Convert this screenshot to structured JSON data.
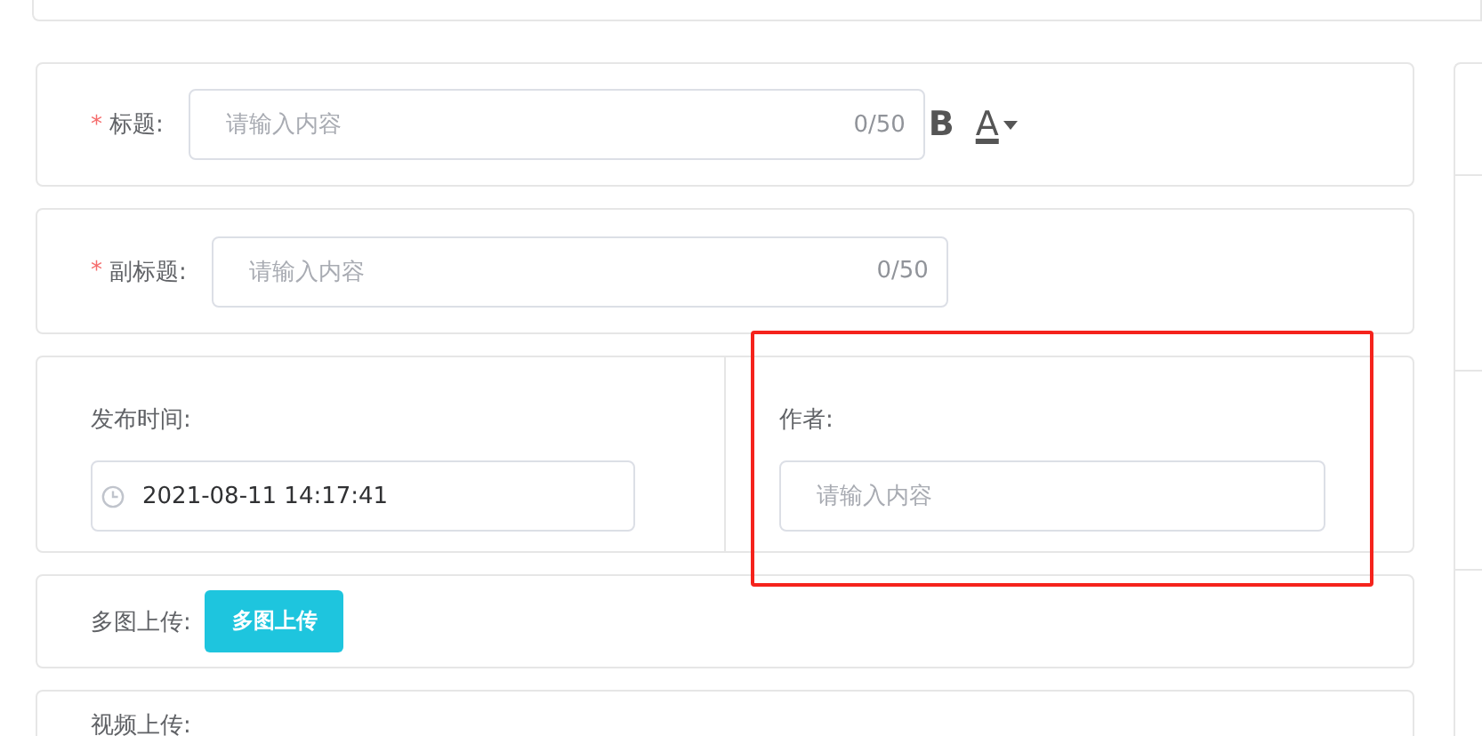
{
  "title_field": {
    "label": "标题:",
    "required_mark": "*",
    "placeholder": "请输入内容",
    "counter": "0/50",
    "bold_tool": "B",
    "color_tool": "A"
  },
  "subtitle_field": {
    "label": "副标题:",
    "required_mark": "*",
    "placeholder": "请输入内容",
    "counter": "0/50"
  },
  "publish_time": {
    "label": "发布时间:",
    "value": "2021-08-11 14:17:41"
  },
  "author": {
    "label": "作者:",
    "placeholder": "请输入内容",
    "highlighted": true
  },
  "image_upload": {
    "label": "多图上传:",
    "button": "多图上传"
  },
  "video_upload": {
    "label": "视频上传:"
  }
}
